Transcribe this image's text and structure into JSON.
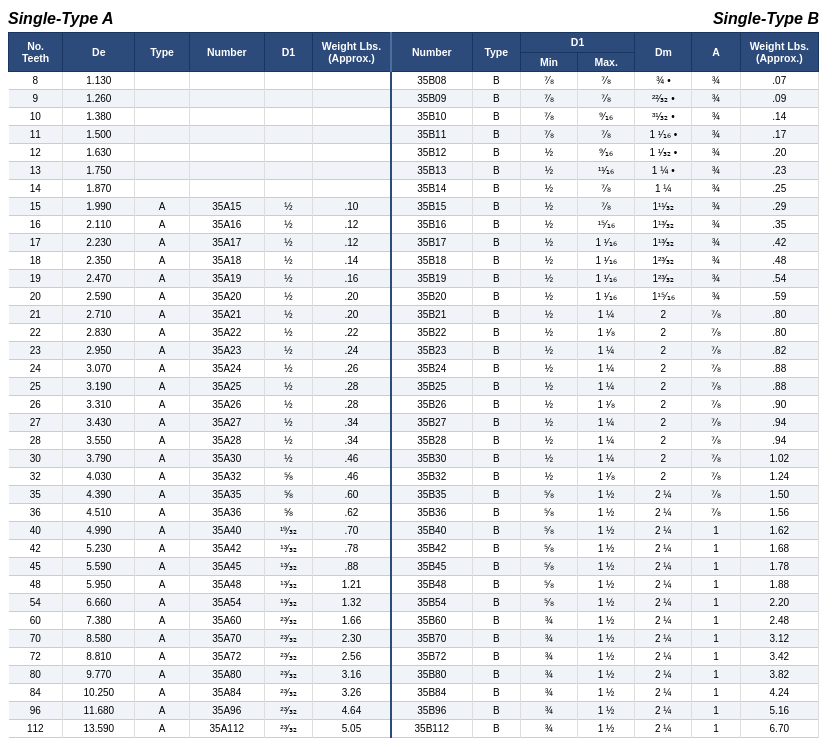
{
  "headers": {
    "singleTypeA": "Single-Type A",
    "singleTypeB": "Single-Type B"
  },
  "columns": {
    "teeth": "No.\nTeeth",
    "de": "De",
    "typeA": "Type",
    "numberA": "Number",
    "d1A": "D1",
    "weightA": "Weight Lbs.\n(Approx.)",
    "numberB": "Number",
    "typeB": "Type",
    "d1min": "Min",
    "d1max": "Max.",
    "dm": "Dm",
    "a": "A",
    "weightB": "Weight Lbs.\n(Approx.)"
  },
  "rows": [
    {
      "teeth": 8,
      "de": "1.130",
      "typeA": "",
      "numberA": "",
      "d1A": "",
      "weightA": "",
      "numberB": "35B08",
      "typeB": "B",
      "d1min": "⁷⁄₈",
      "d1max": "⁷⁄₈",
      "dm": "¾ •",
      "a": "¾",
      "weightB": ".07"
    },
    {
      "teeth": 9,
      "de": "1.260",
      "typeA": "",
      "numberA": "",
      "d1A": "",
      "weightA": "",
      "numberB": "35B09",
      "typeB": "B",
      "d1min": "⁷⁄₈",
      "d1max": "⁷⁄₈",
      "dm": "²²⁄₃₂ •",
      "a": "¾",
      "weightB": ".09"
    },
    {
      "teeth": 10,
      "de": "1.380",
      "typeA": "",
      "numberA": "",
      "d1A": "",
      "weightA": "",
      "numberB": "35B10",
      "typeB": "B",
      "d1min": "⁷⁄₈",
      "d1max": "⁹⁄₁₆",
      "dm": "³¹⁄₃₂ •",
      "a": "¾",
      "weightB": ".14"
    },
    {
      "teeth": 11,
      "de": "1.500",
      "typeA": "",
      "numberA": "",
      "d1A": "",
      "weightA": "",
      "numberB": "35B11",
      "typeB": "B",
      "d1min": "⁷⁄₈",
      "d1max": "⁷⁄₈",
      "dm": "1 ¹⁄₁₆ •",
      "a": "¾",
      "weightB": ".17"
    },
    {
      "teeth": 12,
      "de": "1.630",
      "typeA": "",
      "numberA": "",
      "d1A": "",
      "weightA": "",
      "numberB": "35B12",
      "typeB": "B",
      "d1min": "½",
      "d1max": "⁹⁄₁₆",
      "dm": "1 ¹⁄₃₂ •",
      "a": "¾",
      "weightB": ".20"
    },
    {
      "teeth": 13,
      "de": "1.750",
      "typeA": "",
      "numberA": "",
      "d1A": "",
      "weightA": "",
      "numberB": "35B13",
      "typeB": "B",
      "d1min": "½",
      "d1max": "¹¹⁄₁₆",
      "dm": "1 ¼ •",
      "a": "¾",
      "weightB": ".23"
    },
    {
      "teeth": 14,
      "de": "1.870",
      "typeA": "",
      "numberA": "",
      "d1A": "",
      "weightA": "",
      "numberB": "35B14",
      "typeB": "B",
      "d1min": "½",
      "d1max": "⁷⁄₈",
      "dm": "1 ¼",
      "a": "¾",
      "weightB": ".25"
    },
    {
      "teeth": 15,
      "de": "1.990",
      "typeA": "A",
      "numberA": "35A15",
      "d1A": "½",
      "weightA": ".10",
      "numberB": "35B15",
      "typeB": "B",
      "d1min": "½",
      "d1max": "⁷⁄₈",
      "dm": "1¹¹⁄₃₂",
      "a": "¾",
      "weightB": ".29"
    },
    {
      "teeth": 16,
      "de": "2.110",
      "typeA": "A",
      "numberA": "35A16",
      "d1A": "½",
      "weightA": ".12",
      "numberB": "35B16",
      "typeB": "B",
      "d1min": "½",
      "d1max": "¹⁵⁄₁₆",
      "dm": "1¹³⁄₃₂",
      "a": "¾",
      "weightB": ".35"
    },
    {
      "teeth": 17,
      "de": "2.230",
      "typeA": "A",
      "numberA": "35A17",
      "d1A": "½",
      "weightA": ".12",
      "numberB": "35B17",
      "typeB": "B",
      "d1min": "½",
      "d1max": "1 ¹⁄₁₆",
      "dm": "1¹³⁄₃₂",
      "a": "¾",
      "weightB": ".42"
    },
    {
      "teeth": 18,
      "de": "2.350",
      "typeA": "A",
      "numberA": "35A18",
      "d1A": "½",
      "weightA": ".14",
      "numberB": "35B18",
      "typeB": "B",
      "d1min": "½",
      "d1max": "1 ¹⁄₁₆",
      "dm": "1²³⁄₃₂",
      "a": "¾",
      "weightB": ".48"
    },
    {
      "teeth": 19,
      "de": "2.470",
      "typeA": "A",
      "numberA": "35A19",
      "d1A": "½",
      "weightA": ".16",
      "numberB": "35B19",
      "typeB": "B",
      "d1min": "½",
      "d1max": "1 ¹⁄₁₆",
      "dm": "1²³⁄₃₂",
      "a": "¾",
      "weightB": ".54"
    },
    {
      "teeth": 20,
      "de": "2.590",
      "typeA": "A",
      "numberA": "35A20",
      "d1A": "½",
      "weightA": ".20",
      "numberB": "35B20",
      "typeB": "B",
      "d1min": "½",
      "d1max": "1 ¹⁄₁₆",
      "dm": "1¹⁵⁄₁₆",
      "a": "¾",
      "weightB": ".59"
    },
    {
      "teeth": 21,
      "de": "2.710",
      "typeA": "A",
      "numberA": "35A21",
      "d1A": "½",
      "weightA": ".20",
      "numberB": "35B21",
      "typeB": "B",
      "d1min": "½",
      "d1max": "1 ¼",
      "dm": "2",
      "a": "⁷⁄₈",
      "weightB": ".80"
    },
    {
      "teeth": 22,
      "de": "2.830",
      "typeA": "A",
      "numberA": "35A22",
      "d1A": "½",
      "weightA": ".22",
      "numberB": "35B22",
      "typeB": "B",
      "d1min": "½",
      "d1max": "1 ¹⁄₈",
      "dm": "2",
      "a": "⁷⁄₈",
      "weightB": ".80"
    },
    {
      "teeth": 23,
      "de": "2.950",
      "typeA": "A",
      "numberA": "35A23",
      "d1A": "½",
      "weightA": ".24",
      "numberB": "35B23",
      "typeB": "B",
      "d1min": "½",
      "d1max": "1 ¼",
      "dm": "2",
      "a": "⁷⁄₈",
      "weightB": ".82"
    },
    {
      "teeth": 24,
      "de": "3.070",
      "typeA": "A",
      "numberA": "35A24",
      "d1A": "½",
      "weightA": ".26",
      "numberB": "35B24",
      "typeB": "B",
      "d1min": "½",
      "d1max": "1 ¼",
      "dm": "2",
      "a": "⁷⁄₈",
      "weightB": ".88"
    },
    {
      "teeth": 25,
      "de": "3.190",
      "typeA": "A",
      "numberA": "35A25",
      "d1A": "½",
      "weightA": ".28",
      "numberB": "35B25",
      "typeB": "B",
      "d1min": "½",
      "d1max": "1 ¼",
      "dm": "2",
      "a": "⁷⁄₈",
      "weightB": ".88"
    },
    {
      "teeth": 26,
      "de": "3.310",
      "typeA": "A",
      "numberA": "35A26",
      "d1A": "½",
      "weightA": ".28",
      "numberB": "35B26",
      "typeB": "B",
      "d1min": "½",
      "d1max": "1 ¹⁄₈",
      "dm": "2",
      "a": "⁷⁄₈",
      "weightB": ".90"
    },
    {
      "teeth": 27,
      "de": "3.430",
      "typeA": "A",
      "numberA": "35A27",
      "d1A": "½",
      "weightA": ".34",
      "numberB": "35B27",
      "typeB": "B",
      "d1min": "½",
      "d1max": "1 ¼",
      "dm": "2",
      "a": "⁷⁄₈",
      "weightB": ".94"
    },
    {
      "teeth": 28,
      "de": "3.550",
      "typeA": "A",
      "numberA": "35A28",
      "d1A": "½",
      "weightA": ".34",
      "numberB": "35B28",
      "typeB": "B",
      "d1min": "½",
      "d1max": "1 ¼",
      "dm": "2",
      "a": "⁷⁄₈",
      "weightB": ".94"
    },
    {
      "teeth": 30,
      "de": "3.790",
      "typeA": "A",
      "numberA": "35A30",
      "d1A": "½",
      "weightA": ".46",
      "numberB": "35B30",
      "typeB": "B",
      "d1min": "½",
      "d1max": "1 ¼",
      "dm": "2",
      "a": "⁷⁄₈",
      "weightB": "1.02"
    },
    {
      "teeth": 32,
      "de": "4.030",
      "typeA": "A",
      "numberA": "35A32",
      "d1A": "⁵⁄₈",
      "weightA": ".46",
      "numberB": "35B32",
      "typeB": "B",
      "d1min": "½",
      "d1max": "1 ¹⁄₈",
      "dm": "2",
      "a": "⁷⁄₈",
      "weightB": "1.24"
    },
    {
      "teeth": 35,
      "de": "4.390",
      "typeA": "A",
      "numberA": "35A35",
      "d1A": "⁵⁄₈",
      "weightA": ".60",
      "numberB": "35B35",
      "typeB": "B",
      "d1min": "⁵⁄₈",
      "d1max": "1 ½",
      "dm": "2 ¼",
      "a": "⁷⁄₈",
      "weightB": "1.50"
    },
    {
      "teeth": 36,
      "de": "4.510",
      "typeA": "A",
      "numberA": "35A36",
      "d1A": "⁵⁄₈",
      "weightA": ".62",
      "numberB": "35B36",
      "typeB": "B",
      "d1min": "⁵⁄₈",
      "d1max": "1 ½",
      "dm": "2 ¼",
      "a": "⁷⁄₈",
      "weightB": "1.56"
    },
    {
      "teeth": 40,
      "de": "4.990",
      "typeA": "A",
      "numberA": "35A40",
      "d1A": "¹⁹⁄₃₂",
      "weightA": ".70",
      "numberB": "35B40",
      "typeB": "B",
      "d1min": "⁵⁄₈",
      "d1max": "1 ½",
      "dm": "2 ¼",
      "a": "1",
      "weightB": "1.62"
    },
    {
      "teeth": 42,
      "de": "5.230",
      "typeA": "A",
      "numberA": "35A42",
      "d1A": "¹³⁄₃₂",
      "weightA": ".78",
      "numberB": "35B42",
      "typeB": "B",
      "d1min": "⁵⁄₈",
      "d1max": "1 ½",
      "dm": "2 ¼",
      "a": "1",
      "weightB": "1.68"
    },
    {
      "teeth": 45,
      "de": "5.590",
      "typeA": "A",
      "numberA": "35A45",
      "d1A": "¹³⁄₃₂",
      "weightA": ".88",
      "numberB": "35B45",
      "typeB": "B",
      "d1min": "⁵⁄₈",
      "d1max": "1 ½",
      "dm": "2 ¼",
      "a": "1",
      "weightB": "1.78"
    },
    {
      "teeth": 48,
      "de": "5.950",
      "typeA": "A",
      "numberA": "35A48",
      "d1A": "¹³⁄₃₂",
      "weightA": "1.21",
      "numberB": "35B48",
      "typeB": "B",
      "d1min": "⁵⁄₈",
      "d1max": "1 ½",
      "dm": "2 ¼",
      "a": "1",
      "weightB": "1.88"
    },
    {
      "teeth": 54,
      "de": "6.660",
      "typeA": "A",
      "numberA": "35A54",
      "d1A": "¹³⁄₃₂",
      "weightA": "1.32",
      "numberB": "35B54",
      "typeB": "B",
      "d1min": "⁵⁄₈",
      "d1max": "1 ½",
      "dm": "2 ¼",
      "a": "1",
      "weightB": "2.20"
    },
    {
      "teeth": 60,
      "de": "7.380",
      "typeA": "A",
      "numberA": "35A60",
      "d1A": "²³⁄₃₂",
      "weightA": "1.66",
      "numberB": "35B60",
      "typeB": "B",
      "d1min": "¾",
      "d1max": "1 ½",
      "dm": "2 ¼",
      "a": "1",
      "weightB": "2.48"
    },
    {
      "teeth": 70,
      "de": "8.580",
      "typeA": "A",
      "numberA": "35A70",
      "d1A": "²³⁄₃₂",
      "weightA": "2.30",
      "numberB": "35B70",
      "typeB": "B",
      "d1min": "¾",
      "d1max": "1 ½",
      "dm": "2 ¼",
      "a": "1",
      "weightB": "3.12"
    },
    {
      "teeth": 72,
      "de": "8.810",
      "typeA": "A",
      "numberA": "35A72",
      "d1A": "²³⁄₃₂",
      "weightA": "2.56",
      "numberB": "35B72",
      "typeB": "B",
      "d1min": "¾",
      "d1max": "1 ½",
      "dm": "2 ¼",
      "a": "1",
      "weightB": "3.42"
    },
    {
      "teeth": 80,
      "de": "9.770",
      "typeA": "A",
      "numberA": "35A80",
      "d1A": "²³⁄₃₂",
      "weightA": "3.16",
      "numberB": "35B80",
      "typeB": "B",
      "d1min": "¾",
      "d1max": "1 ½",
      "dm": "2 ¼",
      "a": "1",
      "weightB": "3.82"
    },
    {
      "teeth": 84,
      "de": "10.250",
      "typeA": "A",
      "numberA": "35A84",
      "d1A": "²³⁄₃₂",
      "weightA": "3.26",
      "numberB": "35B84",
      "typeB": "B",
      "d1min": "¾",
      "d1max": "1 ½",
      "dm": "2 ¼",
      "a": "1",
      "weightB": "4.24"
    },
    {
      "teeth": 96,
      "de": "11.680",
      "typeA": "A",
      "numberA": "35A96",
      "d1A": "²³⁄₃₂",
      "weightA": "4.64",
      "numberB": "35B96",
      "typeB": "B",
      "d1min": "¾",
      "d1max": "1 ½",
      "dm": "2 ¼",
      "a": "1",
      "weightB": "5.16"
    },
    {
      "teeth": 112,
      "de": "13.590",
      "typeA": "A",
      "numberA": "35A112",
      "d1A": "²³⁄₃₂",
      "weightA": "5.05",
      "numberB": "35B112",
      "typeB": "B",
      "d1min": "¾",
      "d1max": "1 ½",
      "dm": "2 ¼",
      "a": "1",
      "weightB": "6.70"
    }
  ]
}
